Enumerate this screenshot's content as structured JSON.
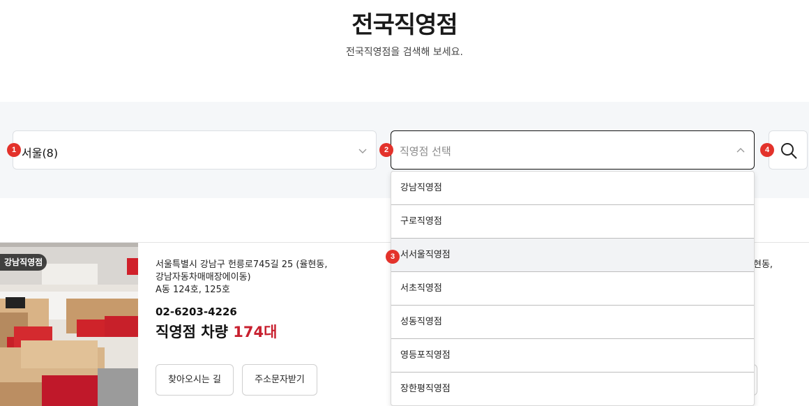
{
  "header": {
    "title": "전국직영점",
    "subtitle": "전국직영점을 검색해 보세요."
  },
  "search": {
    "region_value": "서울(8)",
    "branch_placeholder": "직영점 선택",
    "markers": [
      "1",
      "2",
      "3",
      "4"
    ]
  },
  "dropdown": {
    "options": [
      "강남직영점",
      "구로직영점",
      "서서울직영점",
      "서초직영점",
      "성동직영점",
      "영등포직영점",
      "장한평직영점"
    ],
    "highlighted": "서서울직영점"
  },
  "store": {
    "badge": "강남직영점",
    "address_line1": "서울특별시 강남구 헌릉로745길 25 (율현동,",
    "address_line2": "강남자동차매매장에이동)",
    "address_line3": "A동 124호, 125호",
    "phone": "02-6203-4226",
    "cars_label": "직영점 차량",
    "cars_count": "174대",
    "directions_label": "찾아오시는 길",
    "sms_label": "주소문자받기",
    "clipped_text": "현동,"
  },
  "colors": {
    "accent_red": "#c8202f",
    "marker_red": "#e3322b",
    "band_bg": "#f5f7f9"
  },
  "icons": [
    "chevron-down-icon",
    "chevron-up-icon",
    "search-icon"
  ]
}
